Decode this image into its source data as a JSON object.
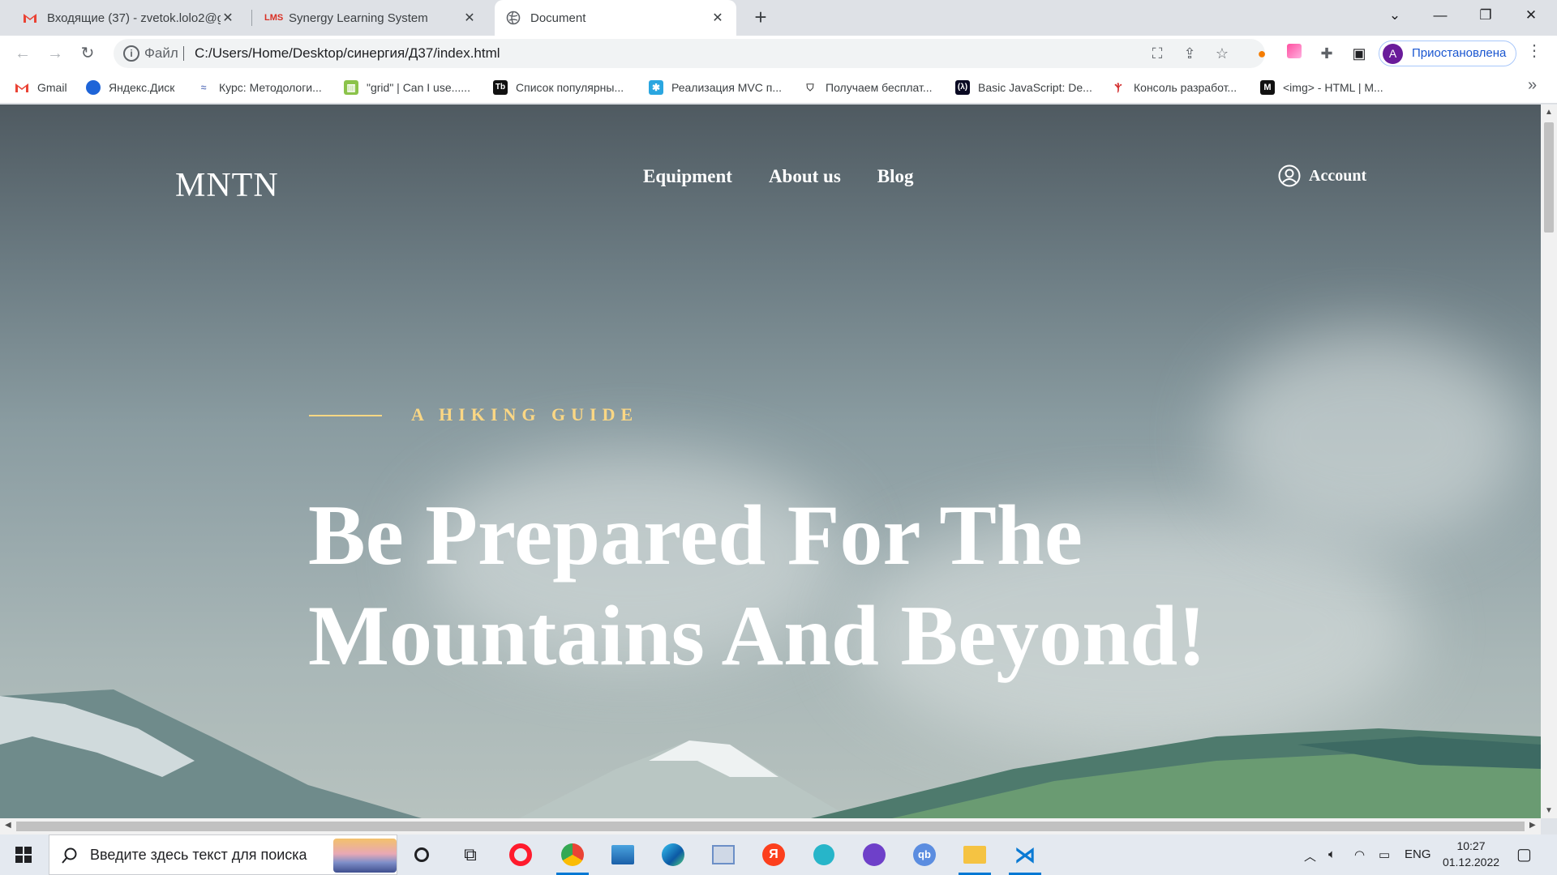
{
  "browser": {
    "tabs": [
      {
        "title": "Входящие (37) - zvetok.lolo2@g",
        "favicon": "gmail-icon",
        "active": false
      },
      {
        "title": "Synergy Learning System",
        "favicon": "lms-icon",
        "active": false
      },
      {
        "title": "Document",
        "favicon": "globe-icon",
        "active": true
      }
    ],
    "address": {
      "scheme_label": "Файл",
      "url": "C:/Users/Home/Desktop/синергия/Д37/index.html"
    },
    "profile": {
      "initial": "A",
      "label": "Приостановлена"
    },
    "bookmarks": [
      {
        "label": "Gmail",
        "icon": "gmail-icon"
      },
      {
        "label": "Яндекс.Диск",
        "icon": "yandex-disk-icon"
      },
      {
        "label": "Курс: Методологи...",
        "icon": "course-icon"
      },
      {
        "label": "\"grid\" | Can I use......",
        "icon": "caniuse-icon"
      },
      {
        "label": "Список популярны...",
        "icon": "tb-icon"
      },
      {
        "label": "Реализация MVC п...",
        "icon": "mvc-icon"
      },
      {
        "label": "Получаем бесплат...",
        "icon": "shield-icon"
      },
      {
        "label": "Basic JavaScript: De...",
        "icon": "fcc-icon"
      },
      {
        "label": "Консоль разработ...",
        "icon": "console-icon"
      },
      {
        "label": "<img> - HTML | M...",
        "icon": "mdn-icon"
      }
    ]
  },
  "site": {
    "logo": "MNTN",
    "nav": [
      "Equipment",
      "About us",
      "Blog"
    ],
    "account_label": "Account",
    "eyebrow": "A HIKING GUIDE",
    "hero_line1": "Be Prepared For The",
    "hero_line2": "Mountains And Beyond!",
    "colors": {
      "accent": "#fbd784",
      "text": "#ffffff"
    }
  },
  "taskbar": {
    "search_placeholder": "Введите здесь текст для поиска",
    "lang": "ENG",
    "time": "10:27",
    "date": "01.12.2022"
  }
}
